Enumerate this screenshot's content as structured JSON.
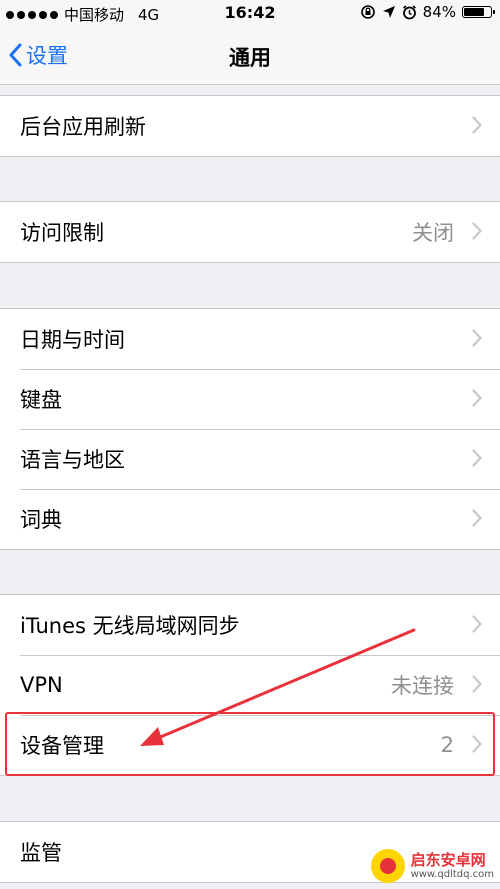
{
  "status": {
    "carrier": "中国移动",
    "network": "4G",
    "time": "16:42",
    "battery_text": "84%",
    "battery_level": 0.84
  },
  "nav": {
    "back_label": "设置",
    "title": "通用"
  },
  "groups": [
    {
      "rows": [
        {
          "label": "后台应用刷新",
          "value": ""
        }
      ]
    },
    {
      "rows": [
        {
          "label": "访问限制",
          "value": "关闭"
        }
      ]
    },
    {
      "rows": [
        {
          "label": "日期与时间",
          "value": ""
        },
        {
          "label": "键盘",
          "value": ""
        },
        {
          "label": "语言与地区",
          "value": ""
        },
        {
          "label": "词典",
          "value": ""
        }
      ]
    },
    {
      "rows": [
        {
          "label": "iTunes 无线局域网同步",
          "value": ""
        },
        {
          "label": "VPN",
          "value": "未连接"
        },
        {
          "label": "设备管理",
          "value": "2"
        }
      ]
    },
    {
      "rows": [
        {
          "label": "监管",
          "value": ""
        }
      ]
    }
  ],
  "colors": {
    "accent": "#1a73f5",
    "annotation": "#e8323b"
  },
  "watermark": {
    "title": "启东安卓网",
    "url": "www.qdltdq.com"
  }
}
